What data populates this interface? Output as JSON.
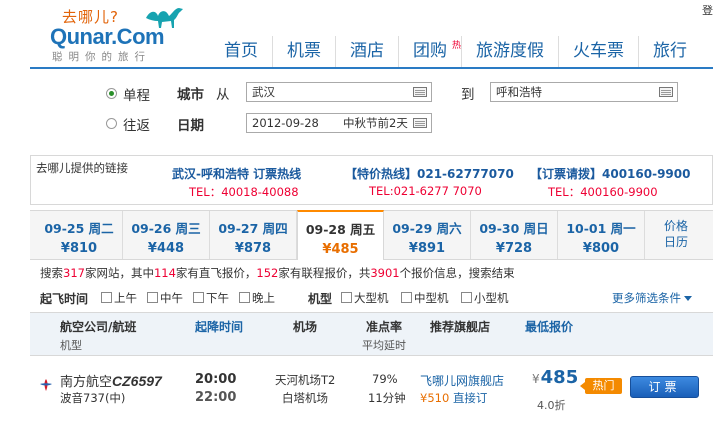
{
  "header": {
    "logo_cn": "去哪儿?",
    "logo_en": "Qunar.Com",
    "logo_sub": "聪明你的旅行",
    "login": "登",
    "nav": [
      {
        "label": "首页"
      },
      {
        "label": "机票"
      },
      {
        "label": "酒店"
      },
      {
        "label": "团购",
        "badge": "热"
      },
      {
        "label": "旅游度假"
      },
      {
        "label": "火车票"
      },
      {
        "label": "旅行"
      }
    ]
  },
  "search": {
    "one_way": "单程",
    "round_trip": "往返",
    "city_label": "城市",
    "from_label": "从",
    "from_value": "武汉",
    "to_label": "到",
    "to_value": "呼和浩特",
    "date_label": "日期",
    "date_value": "2012-09-28",
    "date_note": "中秋节前2天"
  },
  "links": {
    "title": "去哪儿提供的链接",
    "items": [
      {
        "top": "武汉-呼和浩特 订票热线",
        "bottom": "TEL：40018-40088"
      },
      {
        "top": "【特价热线】021-62777070",
        "bottom": "TEL:021-6277 7070"
      },
      {
        "top": "【订票请拨】400160-9900",
        "bottom": "TEL：400160-9900"
      }
    ]
  },
  "date_tabs": [
    {
      "date": "09-25 周二",
      "price": "¥810"
    },
    {
      "date": "09-26 周三",
      "price": "¥448"
    },
    {
      "date": "09-27 周四",
      "price": "¥878"
    },
    {
      "date": "09-28 周五",
      "price": "¥485",
      "selected": true
    },
    {
      "date": "09-29 周六",
      "price": "¥891"
    },
    {
      "date": "09-30 周日",
      "price": "¥728"
    },
    {
      "date": "10-01 周一",
      "price": "¥800"
    }
  ],
  "price_calendar": {
    "line1": "价格",
    "line2": "日历"
  },
  "summary": {
    "t1": "搜索",
    "sites": "317",
    "t2": "家网站，其中",
    "direct": "114",
    "t3": "家有直飞报价，",
    "connect": "152",
    "t4": "家有联程报价，共",
    "total": "3901",
    "t5": "个报价信息，搜索结束"
  },
  "filters": {
    "time_label": "起飞时间",
    "times": [
      "上午",
      "中午",
      "下午",
      "晚上"
    ],
    "type_label": "机型",
    "types": [
      "大型机",
      "中型机",
      "小型机"
    ],
    "more": "更多筛选条件"
  },
  "table_header": {
    "airline": "航空公司/航班",
    "aircraft": "机型",
    "time": "起降时间",
    "airport": "机场",
    "ontime": "准点率",
    "delay": "平均延时",
    "store": "推荐旗舰店",
    "price": "最低报价"
  },
  "flight": {
    "airline": "南方航空",
    "flight_no": "CZ6597",
    "aircraft": "波音737(中)",
    "dep_time": "20:00",
    "arr_time": "22:00",
    "dep_airport": "天河机场T2",
    "arr_airport": "白塔机场",
    "ontime": "79%",
    "delay": "11分钟",
    "store": "飞哪儿网旗舰店",
    "store_price": "¥510",
    "store_action": "直接订",
    "currency": "¥",
    "price": "485",
    "discount": "4.0折",
    "hot_tag": "热门",
    "book": "订票"
  },
  "colors": {
    "brand_blue": "#1b64a6",
    "accent_orange": "#e86e00",
    "price_red": "#ee0033"
  }
}
